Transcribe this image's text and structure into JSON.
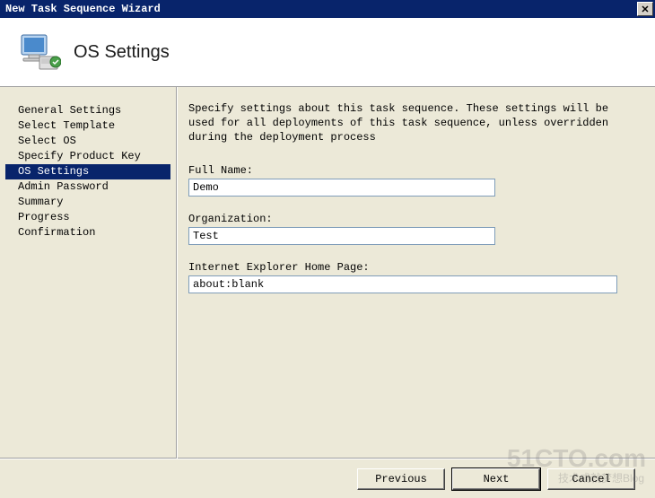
{
  "window": {
    "title": "New Task Sequence Wizard"
  },
  "header": {
    "page_title": "OS Settings"
  },
  "sidebar": {
    "items": [
      {
        "label": "General Settings",
        "selected": false
      },
      {
        "label": "Select Template",
        "selected": false
      },
      {
        "label": "Select OS",
        "selected": false
      },
      {
        "label": "Specify Product Key",
        "selected": false
      },
      {
        "label": "OS Settings",
        "selected": true
      },
      {
        "label": "Admin Password",
        "selected": false
      },
      {
        "label": "Summary",
        "selected": false
      },
      {
        "label": "Progress",
        "selected": false
      },
      {
        "label": "Confirmation",
        "selected": false
      }
    ]
  },
  "content": {
    "description": "Specify settings about this task sequence.  These settings will be used for all deployments of this task sequence, unless overridden during the deployment process",
    "full_name_label": "Full Name:",
    "full_name_value": "Demo",
    "organization_label": "Organization:",
    "organization_value": "Test",
    "ie_home_label": "Internet Explorer Home Page:",
    "ie_home_value": "about:blank"
  },
  "buttons": {
    "previous": "Previous",
    "next": "Next",
    "cancel": "Cancel"
  },
  "watermark": {
    "main": "51CTO.com",
    "sub": "技术成就梦想Blog"
  }
}
